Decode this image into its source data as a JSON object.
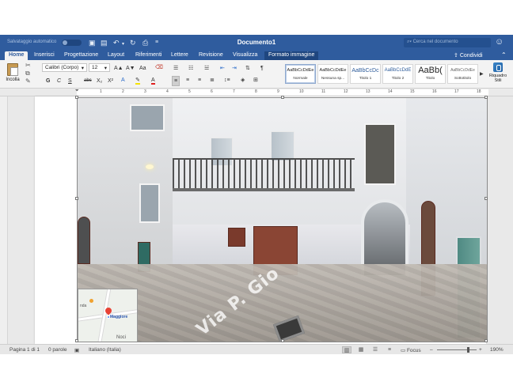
{
  "titlebar": {
    "autosave_label": "Salvataggio automatico",
    "document_title": "Documento1",
    "search_placeholder": "Cerca nel documento"
  },
  "tabs": [
    {
      "label": "Home"
    },
    {
      "label": "Inserisci"
    },
    {
      "label": "Progettazione"
    },
    {
      "label": "Layout"
    },
    {
      "label": "Riferimenti"
    },
    {
      "label": "Lettere"
    },
    {
      "label": "Revisione"
    },
    {
      "label": "Visualizza"
    },
    {
      "label": "Formato immagine"
    }
  ],
  "share_label": "Condividi",
  "ribbon": {
    "paste_label": "Incolla",
    "font_name": "Calibri (Corpo)",
    "font_size": "12",
    "bold": "G",
    "italic": "C",
    "underline": "S",
    "strikethrough": "abc",
    "subscript": "X₂",
    "superscript": "X²",
    "grow_font": "A▲",
    "shrink_font": "A▼",
    "change_case": "Aa",
    "font_color_letter": "A",
    "pilcrow": "¶",
    "styles": [
      {
        "sample": "AaBbCcDdEe",
        "name": "Normale"
      },
      {
        "sample": "AaBbCcDdEe",
        "name": "Nessuna sp..."
      },
      {
        "sample": "AaBbCcDc",
        "name": "Titolo 1"
      },
      {
        "sample": "AaBbCcDdE",
        "name": "Titolo 2"
      },
      {
        "sample": "AaBb(",
        "name": "Titolo"
      },
      {
        "sample": "AaBbCcDdEe",
        "name": "Sottotitolo"
      }
    ],
    "styles_pane_label_line1": "Riquadro",
    "styles_pane_label_line2": "Stili"
  },
  "ruler_numbers": [
    "1",
    "2",
    "3",
    "4",
    "5",
    "6",
    "7",
    "8",
    "9",
    "10",
    "11",
    "12",
    "13",
    "14",
    "15",
    "16",
    "17",
    "18"
  ],
  "image": {
    "street_sign": "Via P. Gio",
    "map": {
      "label_main": "Maggiore",
      "label_a": "Noci",
      "label_b": "nda"
    }
  },
  "statusbar": {
    "page": "Pagina 1 di 1",
    "words": "0 parole",
    "language": "Italiano (Italia)",
    "focus": "Focus",
    "zoom_minus": "–",
    "zoom_plus": "+",
    "zoom_level": "190%",
    "zoom_fraction": 0.78
  },
  "colors": {
    "titlebar_blue": "#2f5c9e",
    "ribbon_bg": "#f3f3f3",
    "font_color": "#e02020",
    "highlight_color": "#f5e200"
  }
}
